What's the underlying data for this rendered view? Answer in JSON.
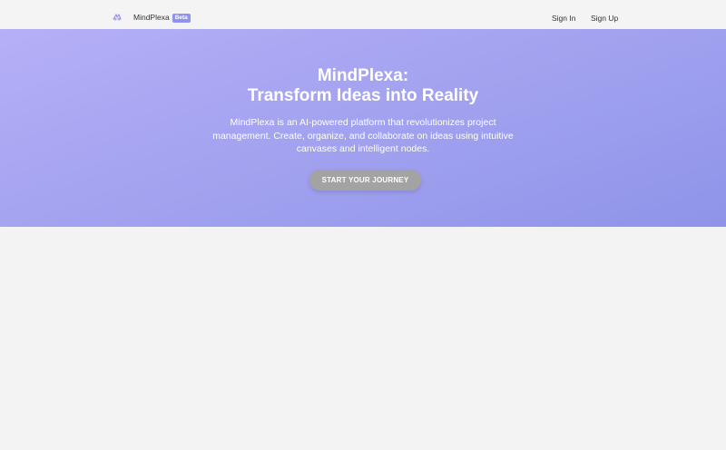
{
  "header": {
    "logo_icon": "brain-sparkle-icon",
    "brand_name": "MindPlexa",
    "badge": "Beta",
    "nav": {
      "sign_in": "Sign In",
      "sign_up": "Sign Up"
    }
  },
  "hero": {
    "title_line1": "MindPlexa:",
    "title_line2": "Transform Ideas into Reality",
    "description": "MindPlexa is an AI-powered platform that revolutionizes project management. Create, organize, and collaborate on ideas using intuitive canvases and intelligent nodes.",
    "cta_label": "START YOUR JOURNEY"
  },
  "colors": {
    "accent": "#8f93f0",
    "hero_gradient_start": "#b5b0f7",
    "hero_gradient_end": "#8f94e9",
    "cta_background": "#a3a3a3",
    "page_background": "#f3f3f3"
  }
}
